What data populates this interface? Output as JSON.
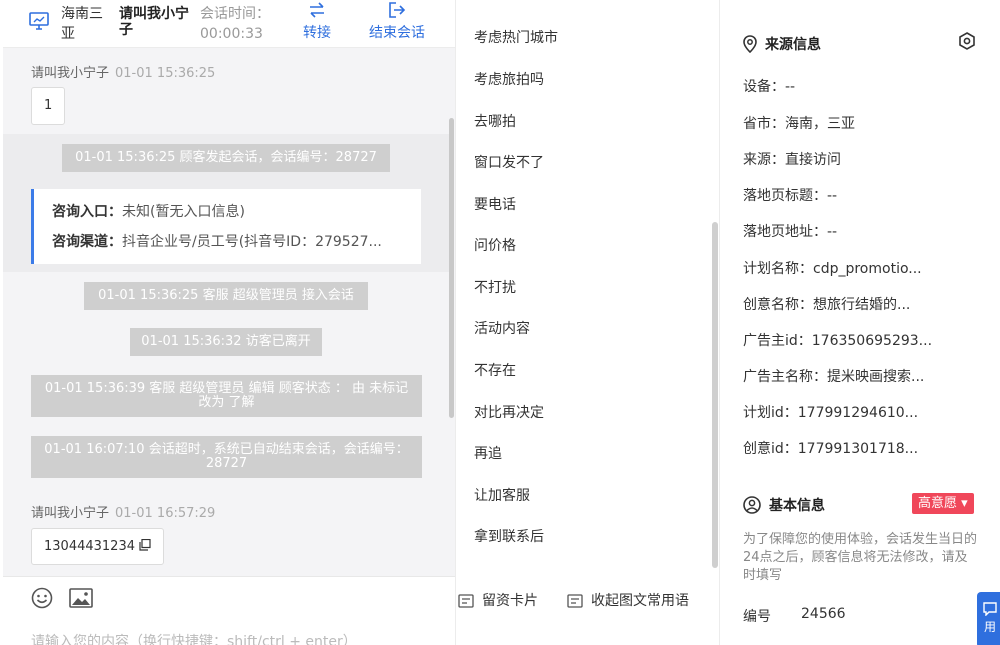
{
  "header": {
    "location": "海南三亚",
    "visitor_name": "请叫我小宁子",
    "session_time_label": "会话时间：",
    "session_time": "00:00:33",
    "transfer_label": "转接",
    "end_label": "结束会话"
  },
  "chat": {
    "messages": [
      {
        "sender": "请叫我小宁子",
        "time": "01-01 15:36:25",
        "text": "1"
      },
      {
        "sender": "请叫我小宁子",
        "time": "01-01 16:57:29",
        "text": "13044431234"
      }
    ],
    "system": [
      "01-01 15:36:25 顾客发起会话，会话编号：28727",
      "01-01 15:36:25 客服 超级管理员 接入会话",
      "01-01 15:36:32 访客已离开",
      "01-01 15:36:39 客服 超级管理员 编辑 顾客状态 ： 由 未标记 改为 了解",
      "01-01 16:07:10 会话超时，系统已自动结束会话，会话编号：28727"
    ],
    "info_card": {
      "entry_label": "咨询入口：",
      "entry_value": "未知(暂无入口信息)",
      "channel_label": "咨询渠道：",
      "channel_value": "抖音企业号/员工号(抖音号ID：279527..."
    },
    "input_placeholder": "请输入您的内容（换行快捷键：shift/ctrl + enter）"
  },
  "phrases": {
    "items": [
      "考虑热门城市",
      "考虑旅拍吗",
      "去哪拍",
      "窗口发不了",
      "要电话",
      "问价格",
      "不打扰",
      "活动内容",
      "不存在",
      "对比再决定",
      "再追",
      "让加客服",
      "拿到联系后"
    ],
    "leave_card": "留资卡片",
    "collapse": "收起图文常用语"
  },
  "info": {
    "source_title": "来源信息",
    "fields": [
      "设备：--",
      "省市：海南，三亚",
      "来源：直接访问",
      "落地页标题：--",
      "落地页地址：--",
      "计划名称：cdp_promotio...",
      "创意名称：想旅行结婚的...",
      "广告主id：176350695293...",
      "广告主名称：提米映画搜索...",
      "计划id：177991294610...",
      "创意id：177991301718..."
    ],
    "basic_title": "基本信息",
    "intent": "高意愿 ▾",
    "notice": "为了保障您的使用体验，会话发生当日的24点之后，顾客信息将无法修改，请及时填写",
    "id_label": "编号",
    "id_value": "24566",
    "float_label": "用"
  },
  "colors": {
    "accent": "#2f6fde",
    "intent_badge": "#f0475a",
    "card_border": "#3b7be8"
  }
}
